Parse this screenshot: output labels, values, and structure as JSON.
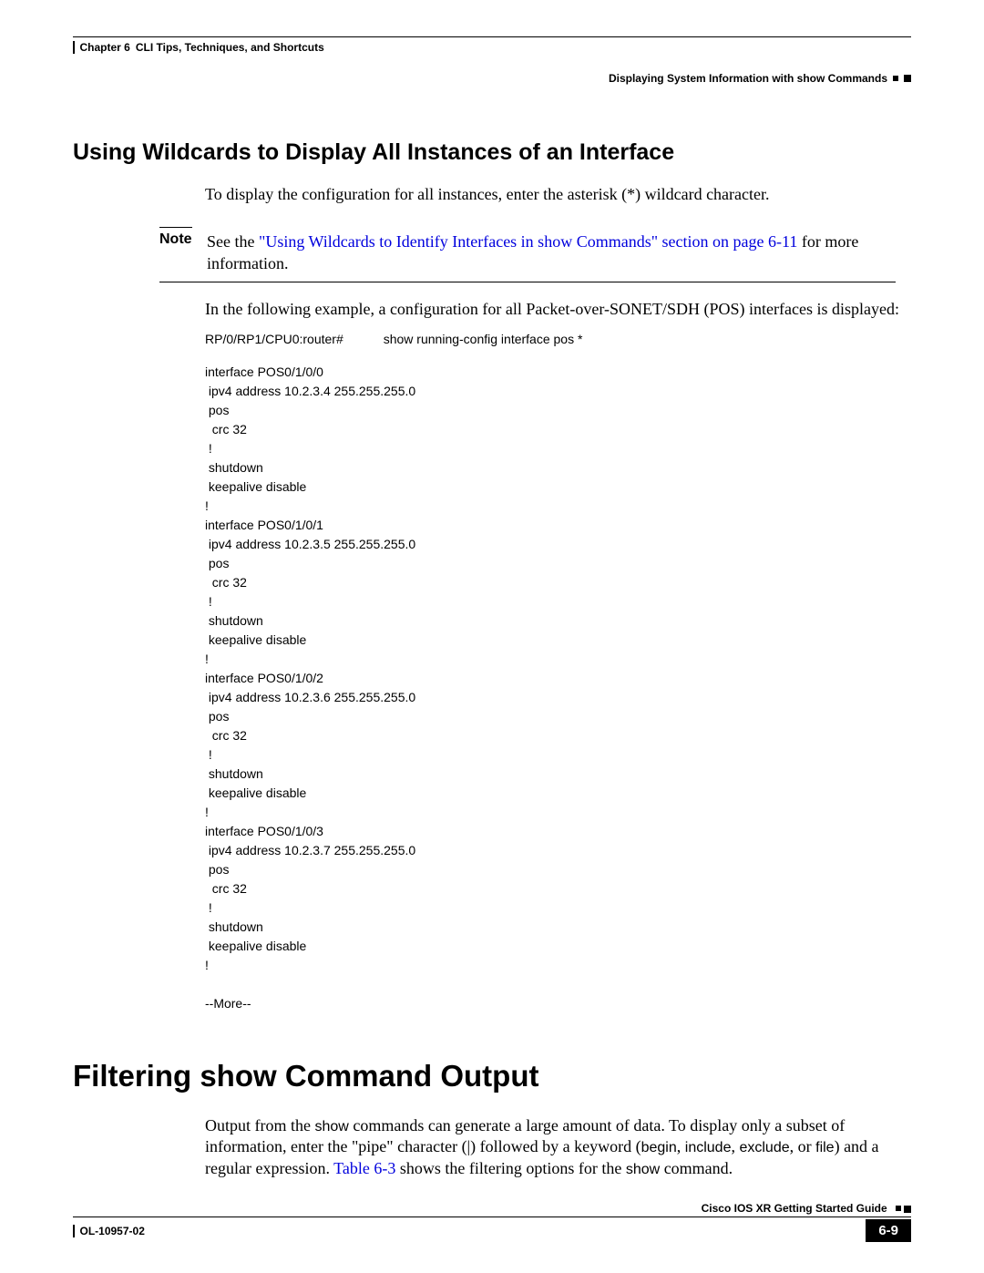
{
  "header": {
    "chapter": "Chapter 6",
    "chapter_title": "CLI Tips, Techniques, and Shortcuts",
    "section_title": "Displaying System Information with show Commands"
  },
  "section1": {
    "heading": "Using Wildcards to Display All Instances of an Interface",
    "intro": "To display the configuration for all instances, enter the asterisk (*) wildcard character.",
    "note_label": "Note",
    "note_before_link": "See the ",
    "note_link": "\"Using Wildcards to Identify Interfaces in show Commands\" section on page 6-11",
    "note_after_link": " for more information.",
    "example_intro": "In the following example, a configuration for all Packet-over-SONET/SDH (POS) interfaces is displayed:",
    "cli_prompt": "RP/0/RP1/CPU0:router#",
    "cli_command": "show running-config interface pos *",
    "cli_output": "interface POS0/1/0/0\n ipv4 address 10.2.3.4 255.255.255.0\n pos\n  crc 32\n !\n shutdown\n keepalive disable\n!\ninterface POS0/1/0/1\n ipv4 address 10.2.3.5 255.255.255.0\n pos\n  crc 32\n !\n shutdown\n keepalive disable\n!\ninterface POS0/1/0/2\n ipv4 address 10.2.3.6 255.255.255.0\n pos\n  crc 32\n !\n shutdown\n keepalive disable\n!\ninterface POS0/1/0/3\n ipv4 address 10.2.3.7 255.255.255.0\n pos\n  crc 32\n !\n shutdown\n keepalive disable\n!\n\n--More--"
  },
  "section2": {
    "heading": "Filtering show Command Output",
    "para_pre": "Output from the ",
    "show_cmd": "show",
    "para_mid1": " commands can generate a large amount of data. To display only a subset of information, enter the \"pipe\" character (|) followed by a keyword (",
    "kw_begin": "begin",
    "kw_include": "include",
    "kw_exclude": "exclude",
    "kw_file": "file",
    "para_mid2": ", ",
    "para_mid3": ", ",
    "para_mid4": ", or ",
    "para_mid5": ") and a regular expression. ",
    "table_link": "Table 6-3",
    "para_mid6": " shows the filtering options for the ",
    "para_end": " command."
  },
  "footer": {
    "guide": "Cisco IOS XR Getting Started Guide",
    "doc_id": "OL-10957-02",
    "page_num": "6-9"
  }
}
